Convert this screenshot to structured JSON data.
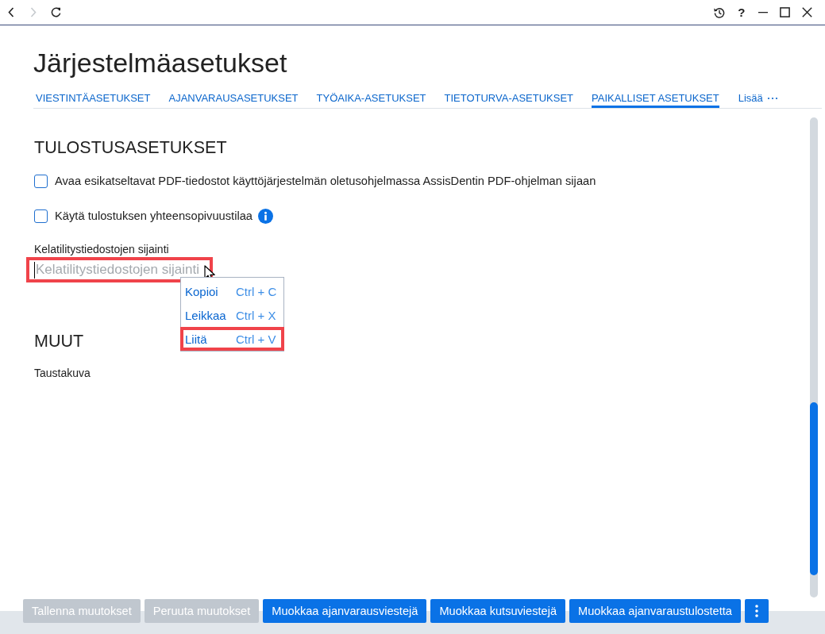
{
  "toolbar": {
    "left": [
      {
        "kind": "back",
        "disabled": false
      },
      {
        "kind": "forward",
        "disabled": true
      },
      {
        "kind": "refresh",
        "disabled": false
      }
    ],
    "right": [
      {
        "kind": "history"
      },
      {
        "kind": "help",
        "label": "?"
      },
      {
        "kind": "minimize"
      },
      {
        "kind": "maximize"
      },
      {
        "kind": "close"
      }
    ]
  },
  "page": {
    "title": "Järjestelmäasetukset"
  },
  "tabs": [
    {
      "label": "VIESTINTÄASETUKSET",
      "selected": false
    },
    {
      "label": "AJANVARAUSASETUKSET",
      "selected": false
    },
    {
      "label": "TYÖAIKA-ASETUKSET",
      "selected": false
    },
    {
      "label": "TIETOTURVA-ASETUKSET",
      "selected": false
    },
    {
      "label": "PAIKALLISET ASETUKSET",
      "selected": true
    }
  ],
  "more_tab": {
    "label": "Lisää"
  },
  "sections": [
    {
      "heading": "TULOSTUSASETUKSET",
      "fields": [
        {
          "kind": "checkbox",
          "label": "Avaa esikatseltavat PDF-tiedostot käyttöjärjestelmän oletusohjelmassa AssisDentin PDF-ohjelman sijaan",
          "checked": false,
          "info": false
        },
        {
          "kind": "checkbox",
          "label": "Käytä tulostuksen yhteensopivuustilaa",
          "checked": false,
          "info": true
        },
        {
          "kind": "text",
          "label": "Kelatilitystiedostojen sijainti",
          "placeholder": "Kelatilitystiedostojen sijainti",
          "focused": true,
          "highlighted": true,
          "menu": {
            "items": [
              {
                "label": "Kopioi",
                "shortcut": "Ctrl + C",
                "highlighted": false
              },
              {
                "label": "Leikkaa",
                "shortcut": "Ctrl + X",
                "highlighted": false
              },
              {
                "label": "Liitä",
                "shortcut": "Ctrl + V",
                "highlighted": true
              }
            ]
          }
        }
      ]
    },
    {
      "heading": "MUUT",
      "fields": [
        {
          "kind": "caption",
          "label": "Taustakuva"
        }
      ]
    }
  ],
  "footer": {
    "buttons": [
      {
        "label": "Tallenna muutokset",
        "disabled": true
      },
      {
        "label": "Peruuta muutokset",
        "disabled": true
      },
      {
        "label": "Muokkaa ajanvarausviestejä",
        "disabled": false
      },
      {
        "label": "Muokkaa kutsuviestejä",
        "disabled": false
      },
      {
        "label": "Muokkaa ajanvaraustulostetta",
        "disabled": false
      }
    ],
    "more_button": {
      "disabled": false
    }
  }
}
